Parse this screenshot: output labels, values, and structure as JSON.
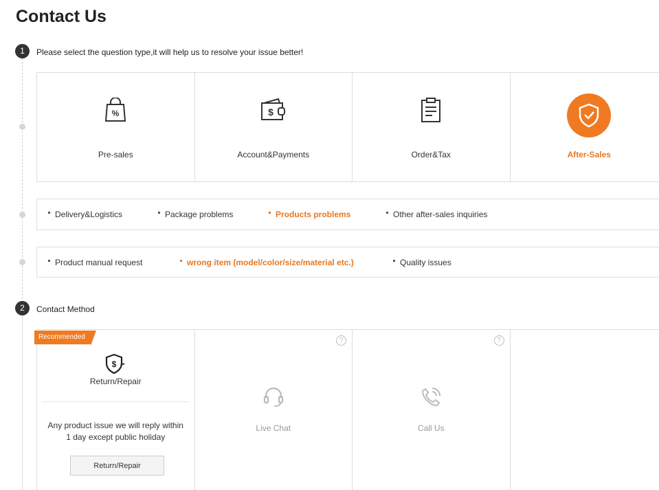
{
  "title": "Contact Us",
  "step1": {
    "num": "1",
    "text": "Please select the question type,it will help us to resolve your issue better!"
  },
  "categories": [
    {
      "label": "Pre-sales",
      "icon": "shopping-bag-percent-icon"
    },
    {
      "label": "Account&Payments",
      "icon": "wallet-dollar-icon"
    },
    {
      "label": "Order&Tax",
      "icon": "clipboard-icon"
    },
    {
      "label": "After-Sales",
      "icon": "shield-check-icon",
      "active": true
    }
  ],
  "subcategories": [
    "Delivery&Logistics",
    "Package problems",
    "Products problems",
    "Other after-sales inquiries"
  ],
  "issues": [
    "Product manual request",
    "wrong item (model/color/size/material etc.)",
    "Quality issues"
  ],
  "step2": {
    "num": "2",
    "text": "Contact Method"
  },
  "methods": {
    "return": {
      "badge": "Recommended",
      "title": "Return/Repair",
      "desc": "Any product issue we will reply within 1 day except public holiday",
      "button": "Return/Repair"
    },
    "chat": {
      "title": "Live Chat",
      "help": "?"
    },
    "call": {
      "title": "Call Us",
      "help": "?"
    }
  },
  "colors": {
    "accent": "#f07a22",
    "accent_text": "#e87722",
    "border": "#dddddd"
  }
}
